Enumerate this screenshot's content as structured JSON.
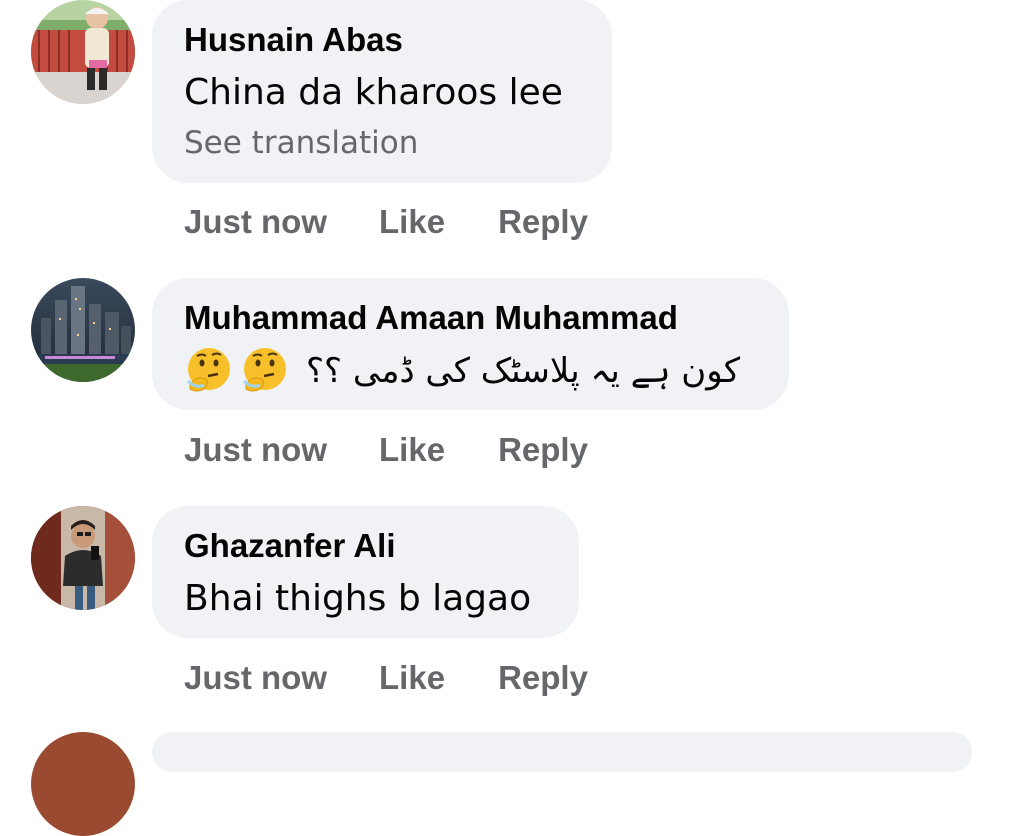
{
  "comments": [
    {
      "author": "Husnain Abas",
      "text": "China da kharoos lee",
      "see_translation": "See translation",
      "time": "Just now",
      "like": "Like",
      "reply": "Reply"
    },
    {
      "author": "Muhammad Amaan Muhammad",
      "text": "کون ہے یہ پلاسٹک کی ڈمی ؟؟",
      "emojis": [
        "thinking-face-emoji",
        "thinking-face-emoji"
      ],
      "time": "Just now",
      "like": "Like",
      "reply": "Reply"
    },
    {
      "author": "Ghazanfer Ali",
      "text": "Bhai thighs b lagao",
      "time": "Just now",
      "like": "Like",
      "reply": "Reply"
    }
  ],
  "colors": {
    "bubble": "#f0f2f5",
    "text": "#050505",
    "muted": "#65676b"
  }
}
